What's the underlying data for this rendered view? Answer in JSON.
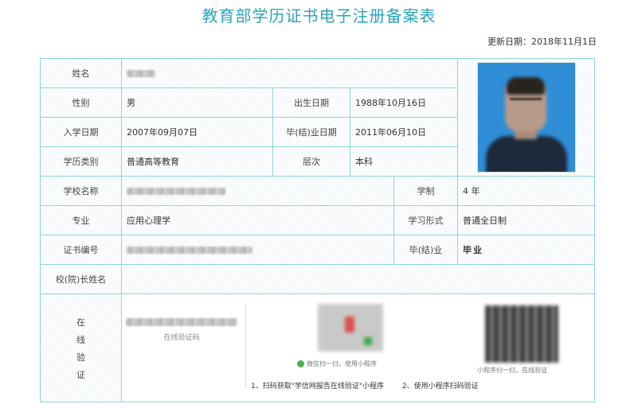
{
  "title": "教育部学历证书电子注册备案表",
  "updated": "更新日期：2018年11月1日",
  "labels": {
    "name": "姓名",
    "gender": "性别",
    "birth_date": "出生日期",
    "enroll_date": "入学日期",
    "graduation_date": "毕(结)业日期",
    "education_type": "学历类别",
    "level": "层次",
    "school_name": "学校名称",
    "duration": "学制",
    "major": "专业",
    "study_mode": "学习形式",
    "cert_no": "证书编号",
    "graduation_status": "毕(结)业",
    "president_name": "校(院)长姓名",
    "online_verify": [
      "在",
      "线",
      "验",
      "证"
    ]
  },
  "values": {
    "gender": "男",
    "birth_date": "1988年10月16日",
    "enroll_date": "2007年09月07日",
    "graduation_date": "2011年06月10日",
    "education_type": "普通高等教育",
    "level": "本科",
    "duration": "4 年",
    "major": "应用心理学",
    "study_mode": "普通全日制",
    "graduation_status": "毕业",
    "president_name": ""
  },
  "verify": {
    "code_caption": "在线验证码",
    "wechat_caption": "微信扫一扫，使用小程序",
    "miniprogram_caption": "小程序扫一扫，在线验证",
    "step1": "1、扫码获取\"学信网报告在线验证\"小程序",
    "step2": "2、使用小程序扫码验证"
  },
  "colors": {
    "title": "#2aa4b7",
    "border": "#8fd3df",
    "photo_bg": "#2f8ed6",
    "wechat_green": "#44b549"
  }
}
